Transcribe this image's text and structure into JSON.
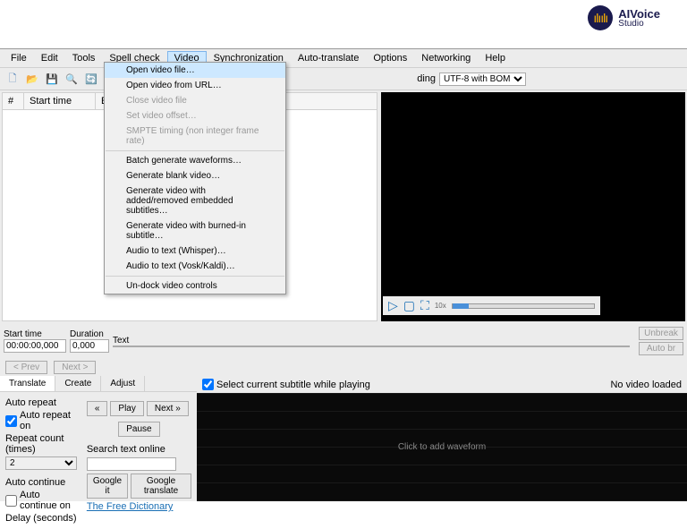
{
  "logo": {
    "name": "AIVoice",
    "sub": "Studio"
  },
  "menu": [
    "File",
    "Edit",
    "Tools",
    "Spell check",
    "Video",
    "Synchronization",
    "Auto-translate",
    "Options",
    "Networking",
    "Help"
  ],
  "encoding": {
    "label": "ding",
    "value": "UTF-8 with BOM"
  },
  "list_cols": {
    "num": "#",
    "start": "Start time",
    "end": "End time"
  },
  "dropdown": [
    {
      "t": "Open video file…",
      "sel": true
    },
    {
      "t": "Open video from URL…"
    },
    {
      "t": "Close video file",
      "dis": true
    },
    {
      "t": "Set video offset…",
      "dis": true
    },
    {
      "t": "SMPTE timing (non integer frame rate)",
      "dis": true
    },
    {
      "sep": true
    },
    {
      "t": "Batch generate waveforms…"
    },
    {
      "t": "Generate blank video…"
    },
    {
      "t": "Generate video with added/removed embedded subtitles…"
    },
    {
      "t": "Generate video with burned-in subtitle…"
    },
    {
      "t": "Audio to text (Whisper)…"
    },
    {
      "t": "Audio to text (Vosk/Kaldi)…"
    },
    {
      "sep": true
    },
    {
      "t": "Un-dock video controls"
    }
  ],
  "edit": {
    "start_lbl": "Start time",
    "dur_lbl": "Duration",
    "text_lbl": "Text",
    "start_val": "00:00:00,000",
    "dur_val": "0,000",
    "unbreak": "Unbreak",
    "autobr": "Auto br"
  },
  "nav": {
    "prev": "< Prev",
    "next": "Next >"
  },
  "tabs": [
    "Translate",
    "Create",
    "Adjust"
  ],
  "auto": {
    "repeat_title": "Auto repeat",
    "repeat_on": "Auto repeat on",
    "count_lbl": "Repeat count (times)",
    "count_val": "2",
    "continue_title": "Auto continue",
    "continue_on": "Auto continue on",
    "delay_lbl": "Delay (seconds)"
  },
  "btns": {
    "back": "«",
    "play": "Play",
    "next": "Next »",
    "pause": "Pause"
  },
  "search": {
    "label": "Search text online",
    "google": "Google it",
    "gtrans": "Google translate",
    "dict": "The Free Dictionary"
  },
  "wave": {
    "check": "Select current subtitle while playing",
    "status": "No video loaded",
    "body": "Click to add waveform"
  },
  "playback": {
    "rate": "10x"
  }
}
